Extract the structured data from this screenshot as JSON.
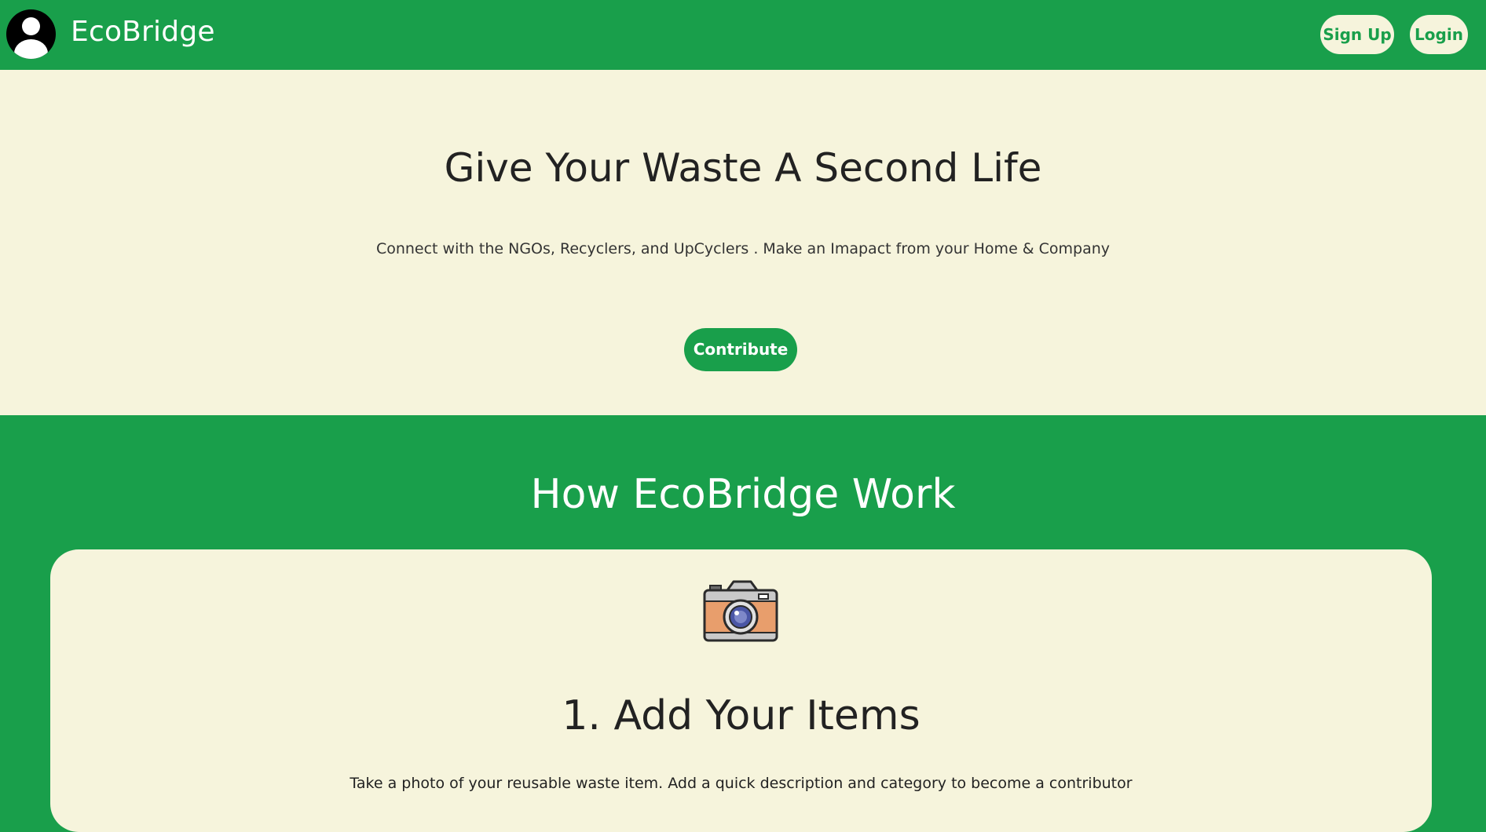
{
  "navbar": {
    "brand": "EcoBridge",
    "signup_label": "Sign Up",
    "login_label": "Login",
    "avatar_icon": "user-avatar-icon"
  },
  "hero": {
    "title": "Give Your Waste A Second Life",
    "subtitle": "Connect with the NGOs, Recyclers, and UpCyclers . Make an Imapact from your Home & Company",
    "cta_label": "Contribute"
  },
  "how_it_works": {
    "title": "How EcoBridge Work",
    "steps": [
      {
        "icon": "camera-icon",
        "title": "1. Add Your Items",
        "description": "Take a photo of your reusable waste item. Add a quick description and category to become a contributor"
      }
    ]
  },
  "colors": {
    "brand_green": "#199f4b",
    "cream": "#f6f4dc",
    "text_dark": "#222222"
  }
}
